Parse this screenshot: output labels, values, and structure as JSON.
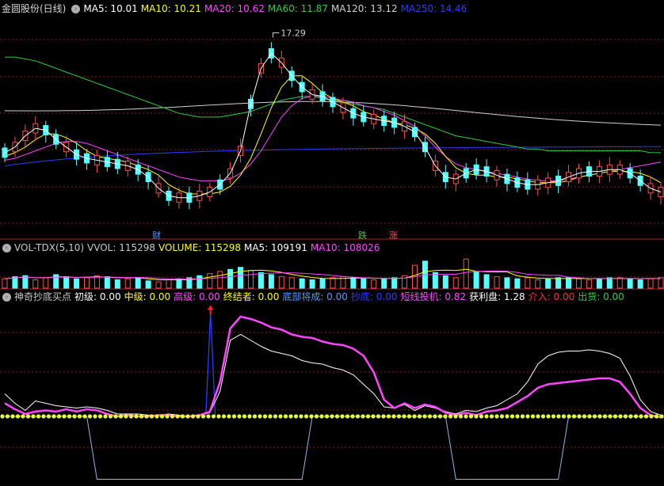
{
  "colors": {
    "up": "#ff4d4d",
    "down": "#54ffff",
    "ma5": "#ffffff",
    "ma10": "#ffff00",
    "ma20": "#ff45ff",
    "ma60": "#2ecc40",
    "ma120": "#d0d0d0",
    "ma250": "#2a3cff",
    "grid": "#8c1a1a",
    "dots": "#e8ff2a"
  },
  "price_panel": {
    "title": "金圆股份(日线)",
    "ma_labels": [
      {
        "text": "MA5: 10.01",
        "color": "#ffffff"
      },
      {
        "text": "MA10: 10.21",
        "color": "#ffff00"
      },
      {
        "text": "MA20: 10.62",
        "color": "#ff45ff"
      },
      {
        "text": "MA60: 11.87",
        "color": "#2ecc40"
      },
      {
        "text": "MA120: 13.12",
        "color": "#d0d0d0"
      },
      {
        "text": "MA250: 14.46",
        "color": "#2a3cff"
      }
    ],
    "peak_label": "17.29",
    "events": [
      {
        "text": "财",
        "color": "#4f9bff"
      },
      {
        "text": "跌",
        "color": "#2ecc40"
      },
      {
        "text": "涨",
        "color": "#ff4d4d"
      }
    ]
  },
  "volume_panel": {
    "indicator_labels": [
      {
        "text": "VOL-TDX(5,10)",
        "color": "#c8c8c8"
      },
      {
        "text": "VVOL: 115298",
        "color": "#c8c8c8"
      },
      {
        "text": "VOLUME: 115298",
        "color": "#ffff00"
      },
      {
        "text": "MA5: 109191",
        "color": "#ffffff"
      },
      {
        "text": "MA10: 108026",
        "color": "#ff45ff"
      }
    ]
  },
  "indicator_panel": {
    "indicator_labels": [
      {
        "text": "神奇抄底买点",
        "color": "#c8c8c8"
      },
      {
        "text": "初级: 0.00",
        "color": "#ffffff"
      },
      {
        "text": "中级: 0.00",
        "color": "#ffff00"
      },
      {
        "text": "高级: 0.00",
        "color": "#ff45ff"
      },
      {
        "text": "终结者: 0.00",
        "color": "#ffff00"
      },
      {
        "text": "底部将成: 0.00",
        "color": "#4f9bff"
      },
      {
        "text": "抄底: 0.00",
        "color": "#2a3cff"
      },
      {
        "text": "短线投机: 0.82",
        "color": "#ff45ff"
      },
      {
        "text": "获利盘: 1.28",
        "color": "#ffffff"
      },
      {
        "text": "介入: 0.00",
        "color": "#ff3030"
      },
      {
        "text": "出货: 0.00",
        "color": "#2ecc40"
      }
    ]
  },
  "chart_data": [
    {
      "type": "candlestick",
      "title": "金圆股份(日线)",
      "series": [
        {
          "name": "MA5",
          "values": [
            10.9,
            11.2,
            11.8,
            12.2,
            12.1,
            11.6,
            11.2,
            10.8,
            10.6,
            10.5,
            10.4,
            10.3,
            10.2,
            10.0,
            9.6,
            9.0,
            8.6,
            8.5,
            8.5,
            8.6,
            8.8,
            9.2,
            9.8,
            11.0,
            13.5,
            15.4,
            16.2,
            15.7,
            15.0,
            14.4,
            14.0,
            13.9,
            13.6,
            13.3,
            13.0,
            12.8,
            12.7,
            12.6,
            12.5,
            12.3,
            12.0,
            11.2,
            10.2,
            9.6,
            9.5,
            9.8,
            10.0,
            9.9,
            9.7,
            9.5,
            9.3,
            9.2,
            9.2,
            9.3,
            9.4,
            9.6,
            9.8,
            9.9,
            9.9,
            10.0,
            10.0,
            9.8,
            9.4,
            9.0,
            8.8
          ]
        },
        {
          "name": "MA10",
          "values": [
            10.7,
            10.9,
            11.2,
            11.6,
            11.9,
            11.9,
            11.7,
            11.4,
            11.0,
            10.7,
            10.6,
            10.5,
            10.4,
            10.2,
            10.0,
            9.7,
            9.2,
            8.9,
            8.7,
            8.7,
            8.7,
            8.8,
            9.1,
            9.7,
            10.6,
            11.9,
            13.3,
            14.4,
            15.0,
            15.0,
            14.6,
            14.1,
            13.8,
            13.6,
            13.4,
            13.1,
            12.9,
            12.7,
            12.5,
            12.4,
            12.2,
            11.9,
            11.4,
            10.7,
            10.1,
            9.8,
            9.7,
            9.7,
            9.6,
            9.6,
            9.5,
            9.4,
            9.3,
            9.3,
            9.3,
            9.4,
            9.6,
            9.7,
            9.8,
            9.9,
            9.9,
            9.9,
            9.8,
            9.6,
            9.3
          ]
        },
        {
          "name": "MA20",
          "values": [
            10.5,
            10.6,
            10.8,
            11.0,
            11.2,
            11.4,
            11.5,
            11.5,
            11.4,
            11.2,
            11.0,
            10.8,
            10.6,
            10.4,
            10.2,
            10.0,
            9.8,
            9.6,
            9.5,
            9.4,
            9.4,
            9.4,
            9.5,
            9.8,
            10.3,
            11.0,
            11.9,
            12.8,
            13.4,
            13.8,
            13.9,
            13.9,
            13.8,
            13.7,
            13.6,
            13.4,
            13.3,
            13.1,
            12.9,
            12.6,
            12.3,
            11.8,
            11.2,
            10.7,
            10.3,
            10.1,
            10.0,
            9.9,
            9.8,
            9.7,
            9.6,
            9.5,
            9.4,
            9.4,
            9.4,
            9.5,
            9.6,
            9.7,
            9.8,
            9.9,
            10.0,
            10.1,
            10.2,
            10.3,
            10.4
          ]
        },
        {
          "name": "MA60",
          "values": [
            16.0,
            16.0,
            15.9,
            15.8,
            15.6,
            15.4,
            15.2,
            15.0,
            14.8,
            14.6,
            14.4,
            14.2,
            14.0,
            13.8,
            13.6,
            13.4,
            13.2,
            13.0,
            12.9,
            12.8,
            12.8,
            12.8,
            12.9,
            13.0,
            13.1,
            13.3,
            13.5,
            13.7,
            13.8,
            13.9,
            13.9,
            13.8,
            13.7,
            13.6,
            13.5,
            13.4,
            13.3,
            13.2,
            13.0,
            12.8,
            12.6,
            12.4,
            12.2,
            12.0,
            11.8,
            11.7,
            11.6,
            11.5,
            11.4,
            11.3,
            11.2,
            11.1,
            11.1,
            11.0,
            11.0,
            11.0,
            11.0,
            11.0,
            11.0,
            11.0,
            11.0,
            11.0,
            11.0,
            10.9,
            10.9
          ]
        }
      ],
      "x": [
        0,
        2,
        4,
        6,
        8,
        10,
        12,
        14,
        16,
        18,
        20,
        22,
        24,
        26,
        28,
        30,
        32,
        34,
        36,
        38,
        40,
        42,
        44,
        46,
        48,
        50,
        52,
        54,
        56,
        58,
        60,
        62,
        64,
        66,
        68,
        70,
        72,
        74,
        76,
        78,
        80,
        82,
        84,
        86,
        88,
        90,
        92,
        94,
        96,
        98,
        100,
        102,
        104,
        106,
        108,
        110,
        112,
        114,
        116,
        118,
        120,
        122,
        124,
        126,
        128
      ],
      "peak": 17.29,
      "ylim": [
        6.8,
        18.2
      ]
    },
    {
      "type": "bar",
      "title": "VOL-TDX(5,10)",
      "values": [
        0.9,
        1.1,
        1.2,
        0.8,
        1.0,
        1.3,
        1.1,
        0.9,
        1.0,
        1.2,
        1.1,
        0.8,
        0.9,
        1.0,
        0.7,
        0.6,
        0.8,
        0.9,
        1.0,
        1.2,
        1.4,
        1.6,
        1.8,
        2.0,
        1.7,
        1.5,
        1.3,
        1.1,
        1.0,
        0.9,
        0.8,
        0.9,
        1.0,
        1.1,
        1.0,
        0.9,
        0.8,
        0.9,
        1.0,
        1.2,
        2.2,
        2.6,
        1.5,
        1.2,
        1.0,
        2.8,
        1.6,
        1.3,
        1.1,
        1.0,
        0.9,
        1.0,
        0.8,
        0.9,
        1.0,
        1.0,
        0.9,
        0.8,
        0.9,
        1.0,
        1.0,
        0.9,
        0.8,
        0.9,
        1.0
      ],
      "ylim": [
        0,
        3.2
      ]
    },
    {
      "type": "line",
      "title": "神奇抄底买点",
      "series": [
        {
          "name": "短线投机",
          "values": [
            22,
            17,
            13,
            15,
            16,
            15,
            17,
            15,
            17,
            16,
            13,
            11,
            12,
            11,
            11,
            12,
            12,
            11,
            11,
            12,
            15,
            40,
            85,
            95,
            93,
            90,
            86,
            84,
            80,
            78,
            77,
            74,
            72,
            71,
            68,
            62,
            48,
            25,
            18,
            22,
            18,
            21,
            19,
            14,
            12,
            14,
            12,
            15,
            16,
            18,
            23,
            28,
            35,
            38,
            39,
            40,
            41,
            42,
            43,
            43,
            40,
            30,
            18,
            12,
            10
          ]
        },
        {
          "name": "获利盘",
          "values": [
            30,
            22,
            16,
            24,
            22,
            20,
            19,
            18,
            19,
            18,
            16,
            13,
            13,
            13,
            12,
            12,
            13,
            12,
            11,
            12,
            14,
            32,
            75,
            80,
            75,
            70,
            66,
            64,
            62,
            58,
            56,
            55,
            52,
            50,
            46,
            38,
            30,
            19,
            18,
            21,
            16,
            20,
            18,
            15,
            13,
            16,
            15,
            18,
            20,
            25,
            30,
            40,
            55,
            62,
            65,
            66,
            66,
            67,
            66,
            64,
            60,
            45,
            25,
            15,
            12
          ]
        },
        {
          "name": "高级",
          "values": [
            0,
            0,
            0,
            0,
            0,
            0,
            0,
            0,
            0,
            0,
            0,
            0,
            0,
            0,
            0,
            0,
            0,
            0,
            0,
            0,
            0,
            0,
            0,
            0,
            0,
            0,
            0,
            0,
            0,
            0,
            0,
            0,
            0,
            0,
            0,
            0,
            0,
            0,
            0,
            0,
            0,
            0,
            0,
            0,
            0,
            0,
            0,
            0,
            0,
            0,
            0,
            0,
            0,
            0,
            0,
            0,
            0,
            0,
            0,
            0,
            0,
            0,
            0,
            0,
            0
          ]
        }
      ],
      "ylim": [
        -45,
        105
      ]
    }
  ]
}
